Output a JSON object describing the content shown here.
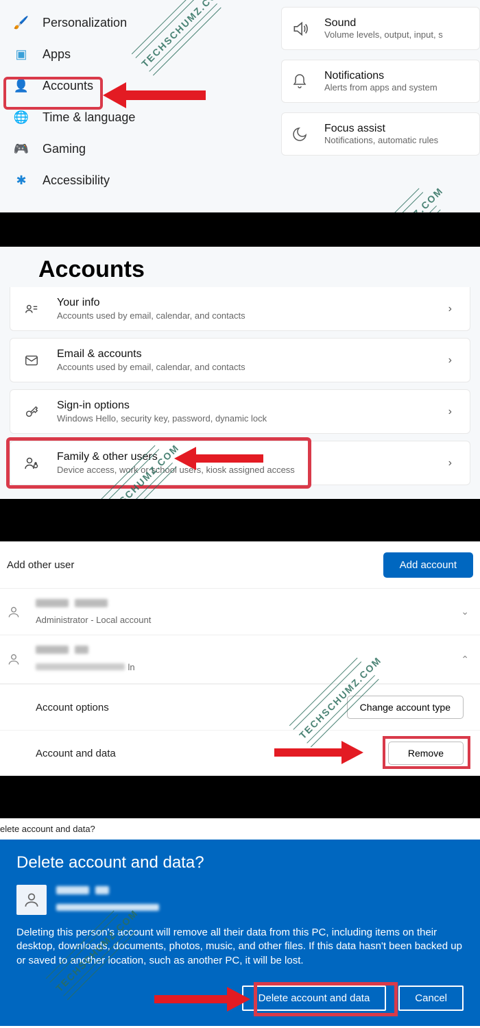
{
  "watermark": "TECHSCHUMZ.COM",
  "section1": {
    "nav": [
      {
        "label": "Personalization",
        "icon": "🖌️",
        "color": "#d97f42"
      },
      {
        "label": "Apps",
        "icon": "▣",
        "color": "#3aa0d8"
      },
      {
        "label": "Accounts",
        "icon": "👤",
        "color": "#2aae6f"
      },
      {
        "label": "Time & language",
        "icon": "🌐",
        "color": "#3aa0d8"
      },
      {
        "label": "Gaming",
        "icon": "🎮",
        "color": "#8a8a8a"
      },
      {
        "label": "Accessibility",
        "icon": "✱",
        "color": "#1a84d6"
      }
    ],
    "cards": [
      {
        "title": "Sound",
        "sub": "Volume levels, output, input, s",
        "icon": "sound"
      },
      {
        "title": "Notifications",
        "sub": "Alerts from apps and system",
        "icon": "bell"
      },
      {
        "title": "Focus assist",
        "sub": "Notifications, automatic rules",
        "icon": "moon"
      }
    ]
  },
  "section2": {
    "heading": "Accounts",
    "rows": [
      {
        "title": "Your info",
        "desc": "Accounts used by email, calendar, and contacts",
        "icon": "person-card"
      },
      {
        "title": "Email & accounts",
        "desc": "Accounts used by email, calendar, and contacts",
        "icon": "mail"
      },
      {
        "title": "Sign-in options",
        "desc": "Windows Hello, security key, password, dynamic lock",
        "icon": "key"
      },
      {
        "title": "Family & other users",
        "desc": "Device access, work or school users, kiosk assigned access",
        "icon": "family"
      }
    ]
  },
  "section3": {
    "add_label": "Add other user",
    "add_button": "Add account",
    "user1_sub": "Administrator - Local account",
    "opt_label": "Account options",
    "opt_button": "Change account type",
    "data_label": "Account and data",
    "remove_button": "Remove"
  },
  "section4": {
    "mini_title": "elete account and data?",
    "heading": "Delete account and data?",
    "body": "Deleting this person's account will remove all their data from this PC, including items on their desktop, downloads, documents, photos, music, and other files. If this data hasn't been backed up or saved to another location, such as another PC, it will be lost.",
    "confirm": "Delete account and data",
    "cancel": "Cancel"
  }
}
